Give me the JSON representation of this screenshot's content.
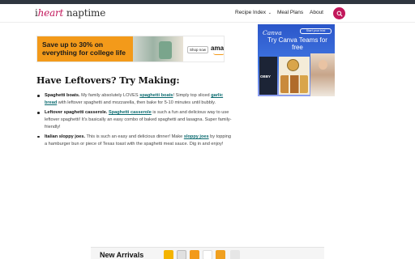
{
  "header": {
    "logo": {
      "i": "i",
      "heart": "heart",
      "naptime": "naptime"
    },
    "nav": {
      "recipe_index": "Recipe Index",
      "recipe_chevron": "⌄",
      "meal_plans": "Meal Plans",
      "about": "About"
    },
    "search_icon": "search-icon",
    "accent_color": "#c2185b"
  },
  "ads": {
    "college": {
      "headline": "Save up to 30% on everything for college life",
      "button": "Shop now",
      "brand": "amazon"
    },
    "canva": {
      "brand": "Canva",
      "trial_button": "Start your trial",
      "title": "Try Canva Teams for free",
      "panel_label": "OBBY"
    },
    "footer": {
      "headline": "New Arrivals"
    }
  },
  "article": {
    "heading": "Have Leftovers? Try Making:",
    "items": [
      {
        "title": "Spaghetti boats.",
        "t1": " My family absolutely LOVES ",
        "link1": "spaghetti boats",
        "t2": "! Simply top sliced ",
        "link2": "garlic bread",
        "t3": " with leftover spaghetti and mozzarella, then bake for 5-10 minutes until bubbly."
      },
      {
        "title": "Leftover spaghetti casserole.",
        "t1": " ",
        "link1": "Spaghetti casserole",
        "t2": " is such a fun and delicious way to use leftover spaghetti! It's basically an easy combo of baked spaghetti and lasagna. Super family-friendly!"
      },
      {
        "title": "Italian sloppy joes.",
        "t1": " This is such an easy and delicious dinner! Make ",
        "link1": "sloppy joes",
        "t2": " by topping a hamburger bun or piece of Texas toast with the spaghetti meat sauce. Dig in and enjoy!"
      }
    ]
  }
}
